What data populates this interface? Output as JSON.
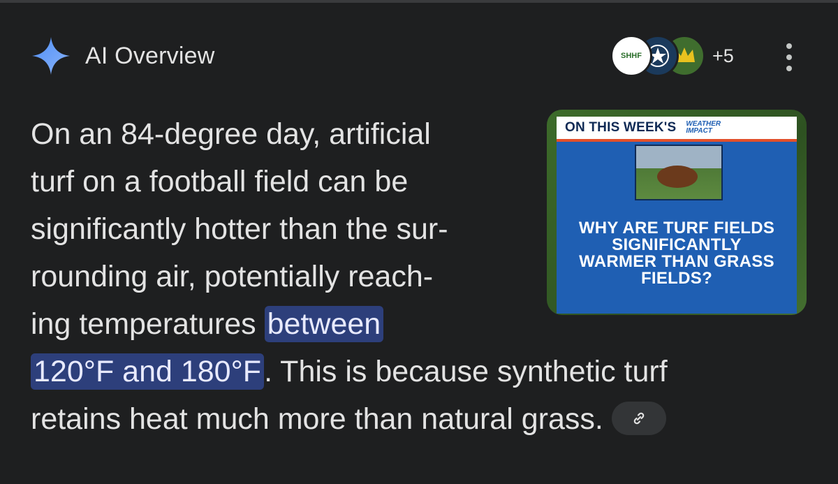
{
  "header": {
    "title": "AI Overview",
    "more_sources": "+5"
  },
  "sources": [
    {
      "icon": "shhf-favicon",
      "label": "SHHF"
    },
    {
      "icon": "star-favicon"
    },
    {
      "icon": "crown-favicon"
    }
  ],
  "overview": {
    "lines": [
      "On an 84-degree day, artificial",
      "turf on a football field can be",
      "significantly hotter than the sur-",
      "rounding air, potentially reach-",
      "ing temperatures "
    ],
    "highlight_1": "between",
    "highlight_2": "120°F and 180°F",
    "after_highlight": ". This is because synthetic turf",
    "last_line": "retains heat much more than natural grass."
  },
  "thumbnail": {
    "banner_left": "ON THIS WEEK'S",
    "banner_right_1": "WEATHER",
    "banner_right_2": "IMPACT",
    "question_lines": [
      "WHY ARE TURF FIELDS",
      "SIGNIFICANTLY",
      "WARMER THAN GRASS",
      "FIELDS?"
    ]
  },
  "colors": {
    "background": "#1e1f20",
    "highlight": "#2d3f7b",
    "thumbnail_blue": "#1f5fb3"
  }
}
